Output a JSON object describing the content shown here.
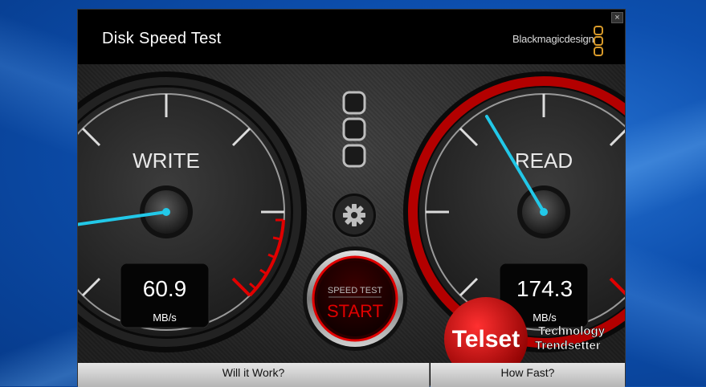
{
  "app": {
    "title": "Disk Speed Test",
    "brand": "Blackmagicdesign",
    "close_glyph": "×"
  },
  "gauges": {
    "write": {
      "label": "WRITE",
      "value": "60.9",
      "unit": "MB/s",
      "color": "#2a2a2a"
    },
    "read": {
      "label": "READ",
      "value": "174.3",
      "unit": "MB/s",
      "color": "#b30000"
    }
  },
  "controls": {
    "start_top": "SPEED TEST",
    "start_main": "START",
    "settings_icon": "gear-icon"
  },
  "tabs": {
    "will_it_work": "Will it Work?",
    "how_fast": "How Fast?"
  },
  "watermark": {
    "badge": "Telset",
    "line1": "Technology",
    "line2": "Trendsetter"
  },
  "colors": {
    "needle": "#22c8e8",
    "redzone": "#e00000",
    "badge": "#d40000"
  }
}
